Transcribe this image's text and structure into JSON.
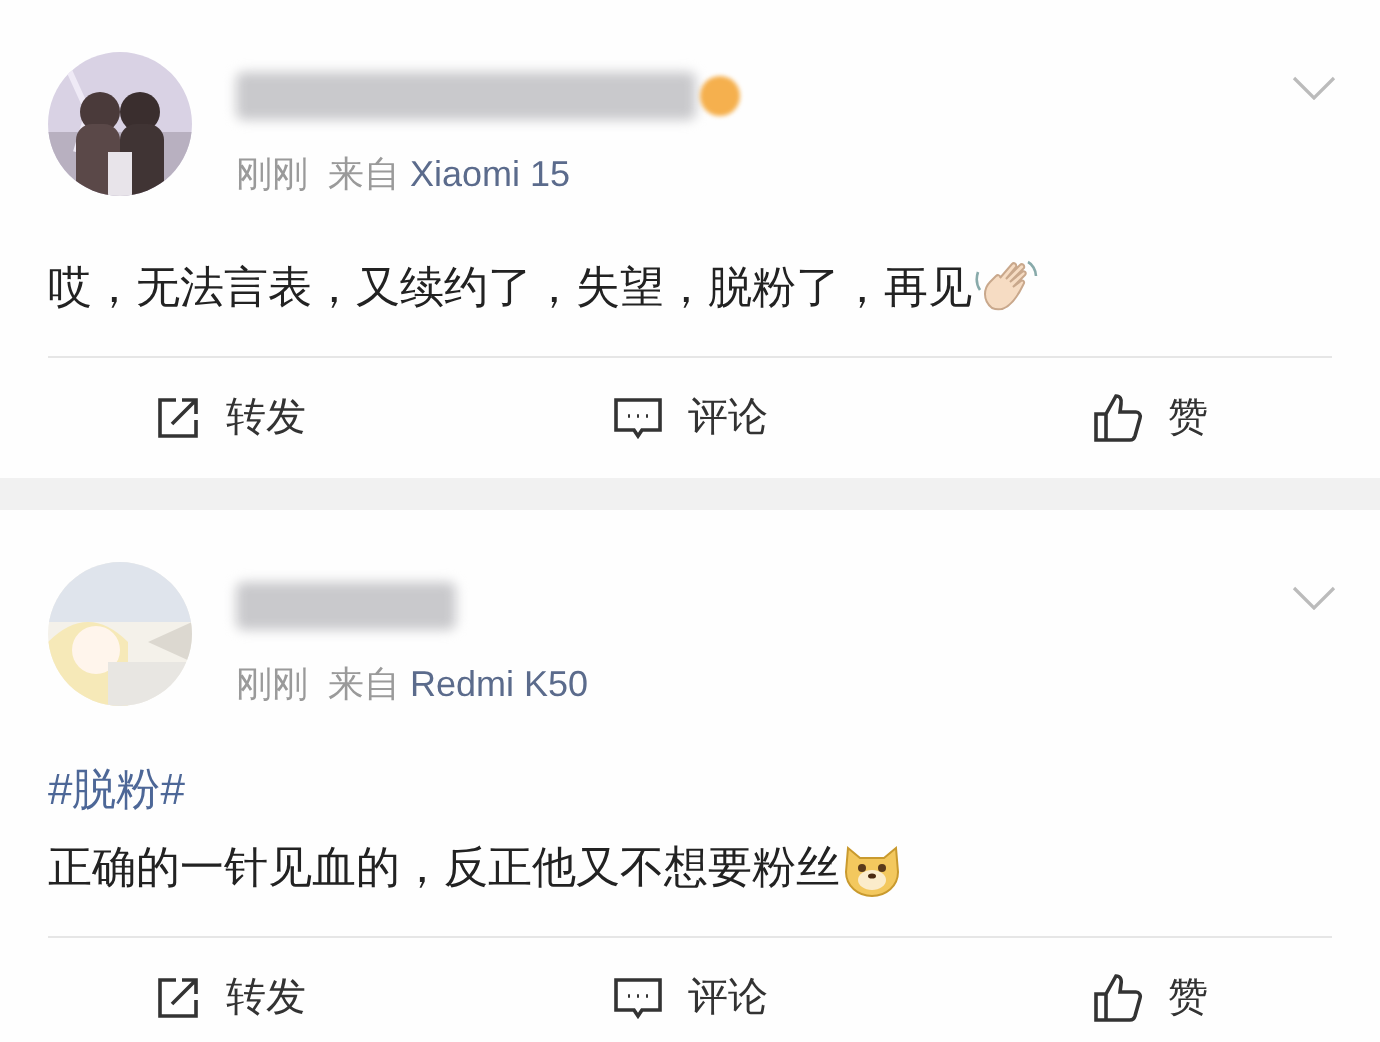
{
  "posts": [
    {
      "time": "刚刚",
      "source_prefix": "来自",
      "device": "Xiaomi 15",
      "verified": true,
      "text": "哎，无法言表，又续约了，失望，脱粉了，再见",
      "emoji": {
        "kind": "wave"
      },
      "actions": [
        {
          "kind": "repost",
          "label": "转发"
        },
        {
          "kind": "comment",
          "label": "评论"
        },
        {
          "kind": "like",
          "label": "赞"
        }
      ]
    },
    {
      "time": "刚刚",
      "source_prefix": "来自",
      "device": "Redmi K50",
      "verified": false,
      "hashtag": "#脱粉#",
      "text": "正确的一针见血的，反正他又不想要粉丝",
      "emoji": {
        "kind": "dog"
      },
      "actions": [
        {
          "kind": "repost",
          "label": "转发"
        },
        {
          "kind": "comment",
          "label": "评论"
        },
        {
          "kind": "like",
          "label": "赞"
        }
      ]
    }
  ]
}
